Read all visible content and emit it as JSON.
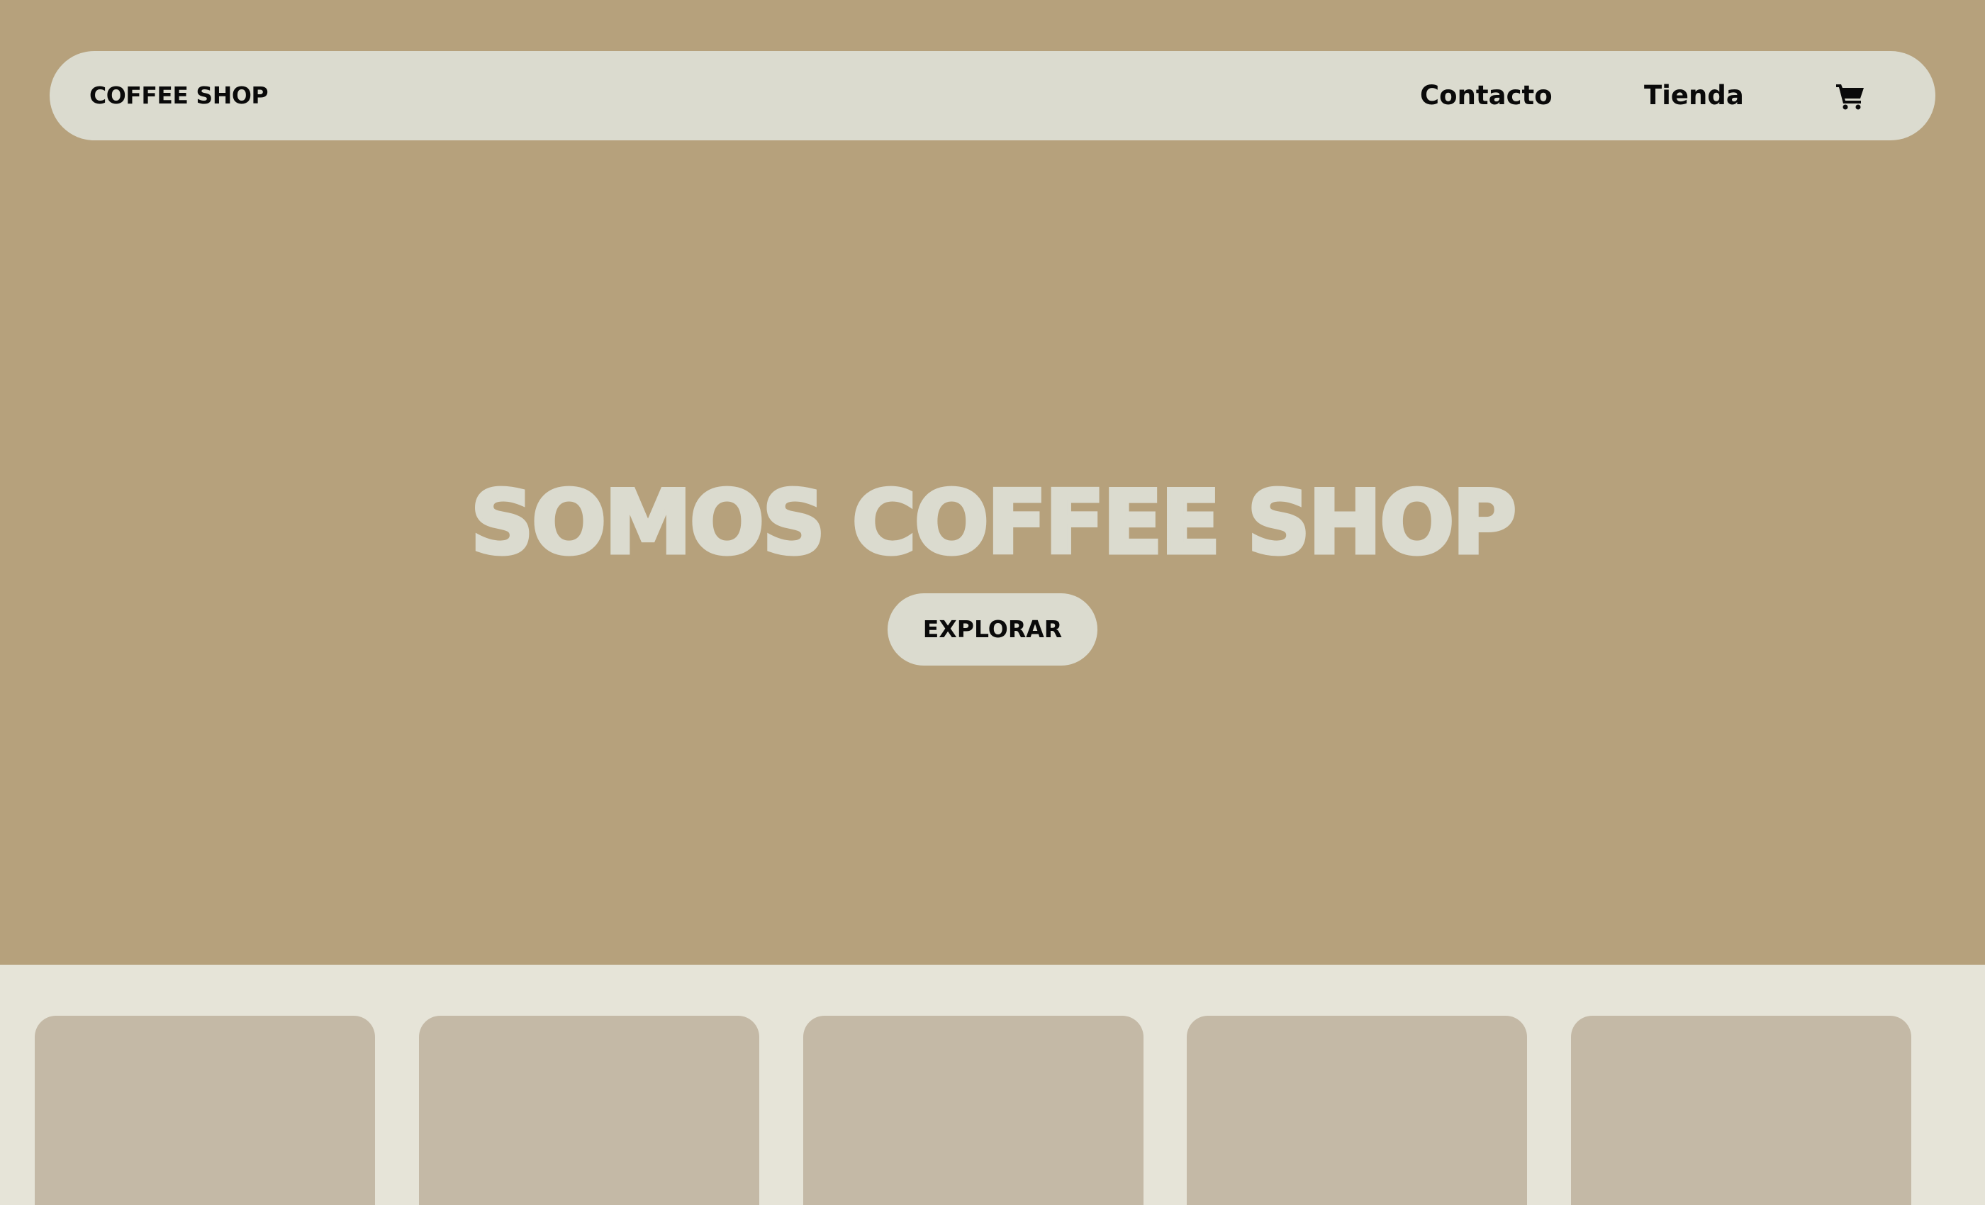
{
  "header": {
    "brand": "COFFEE SHOP",
    "nav": {
      "contacto": "Contacto",
      "tienda": "Tienda"
    },
    "cart_icon": "shopping-cart-icon"
  },
  "hero": {
    "title": "SOMOS COFFEE SHOP",
    "cta_label": "EXPLORAR"
  },
  "products": {
    "card_count": 5
  },
  "colors": {
    "hero_background": "#b6a17c",
    "page_background": "#e6e4d8",
    "nav_background": "#dbdbcf",
    "card_background": "#c4b9a6",
    "text_dark": "#0a0a0a"
  }
}
